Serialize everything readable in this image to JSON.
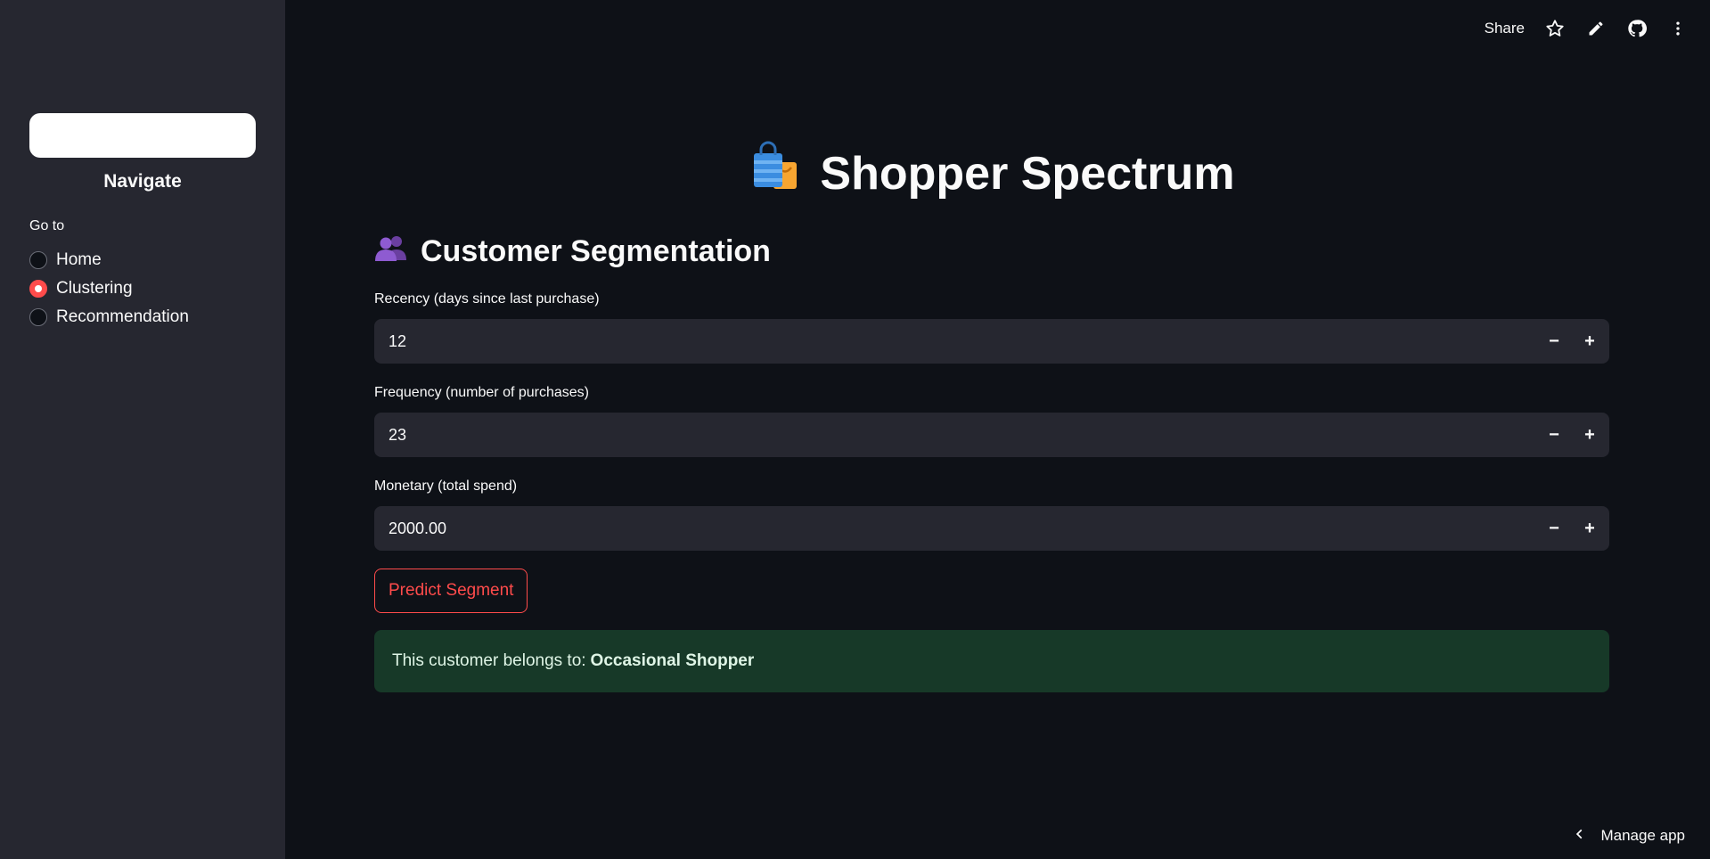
{
  "sidebar": {
    "title": "Navigate",
    "radio_label": "Go to",
    "options": [
      "Home",
      "Clustering",
      "Recommendation"
    ],
    "selected": "Clustering"
  },
  "toolbar": {
    "share_label": "Share",
    "icons": [
      "star-icon",
      "pencil-icon",
      "github-icon",
      "more-vertical-icon"
    ]
  },
  "header": {
    "title": "Shopper Spectrum",
    "icon": "shopping-bags-icon"
  },
  "section": {
    "title": "Customer Segmentation",
    "icon": "people-icon"
  },
  "fields": {
    "recency": {
      "label": "Recency (days since last purchase)",
      "value": "12"
    },
    "frequency": {
      "label": "Frequency (number of purchases)",
      "value": "23"
    },
    "monetary": {
      "label": "Monetary (total spend)",
      "value": "2000.00"
    }
  },
  "stepper": {
    "minus": "−",
    "plus": "+"
  },
  "predict_button": "Predict Segment",
  "result": {
    "prefix": "This customer belongs to:",
    "segment": "Occasional Shopper"
  },
  "footer": {
    "manage_label": "Manage app"
  },
  "colors": {
    "accent": "#ff4b4b",
    "background": "#0e1117",
    "sidebar": "#262730",
    "success_bg": "#173928"
  }
}
